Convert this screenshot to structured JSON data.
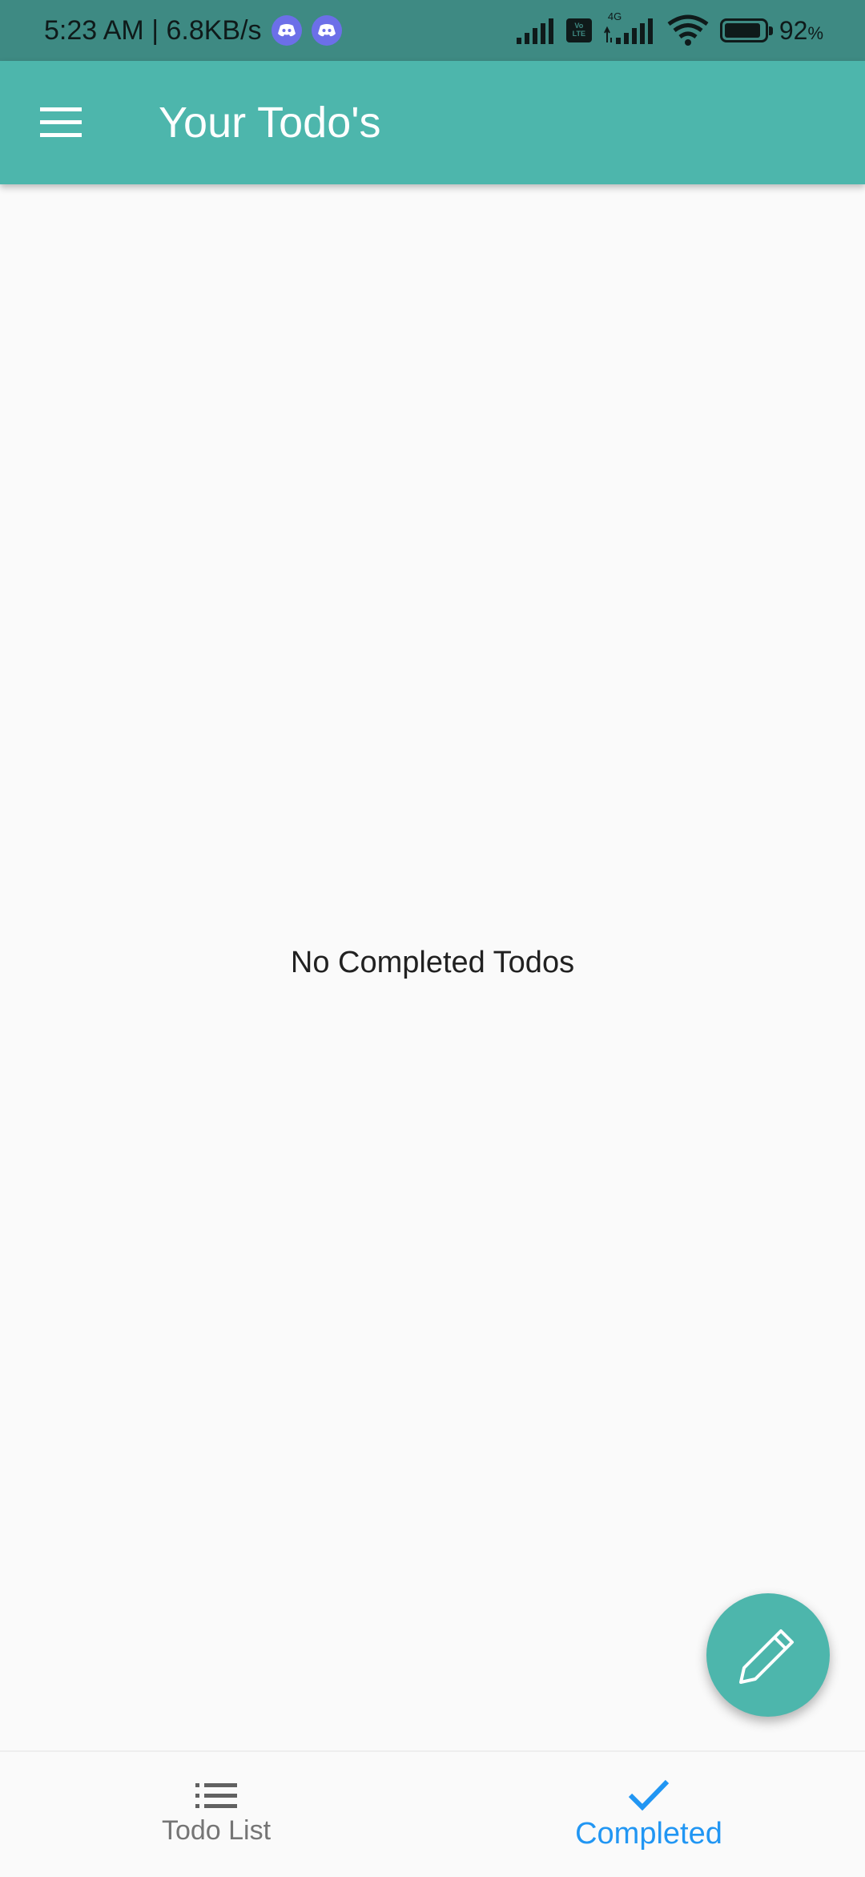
{
  "status_bar": {
    "time_speed": "5:23 AM | 6.8KB/s",
    "network_type": "4G",
    "volte_top": "Vo",
    "volte_bottom": "LTE",
    "battery": "92",
    "battery_unit": "%",
    "battery_level": 0.92
  },
  "app_bar": {
    "title": "Your Todo's",
    "menu_icon": "hamburger-menu-icon"
  },
  "main": {
    "empty_message": "No Completed Todos"
  },
  "fab": {
    "icon": "pencil-icon"
  },
  "bottom_nav": {
    "items": [
      {
        "label": "Todo List",
        "icon": "list-icon",
        "active": false
      },
      {
        "label": "Completed",
        "icon": "check-icon",
        "active": true
      }
    ]
  },
  "colors": {
    "primary": "#4DB6AC",
    "status_bar": "#3E8A83",
    "active_nav": "#2196F3",
    "inactive_nav": "#757575",
    "background": "#FAFAFA"
  }
}
